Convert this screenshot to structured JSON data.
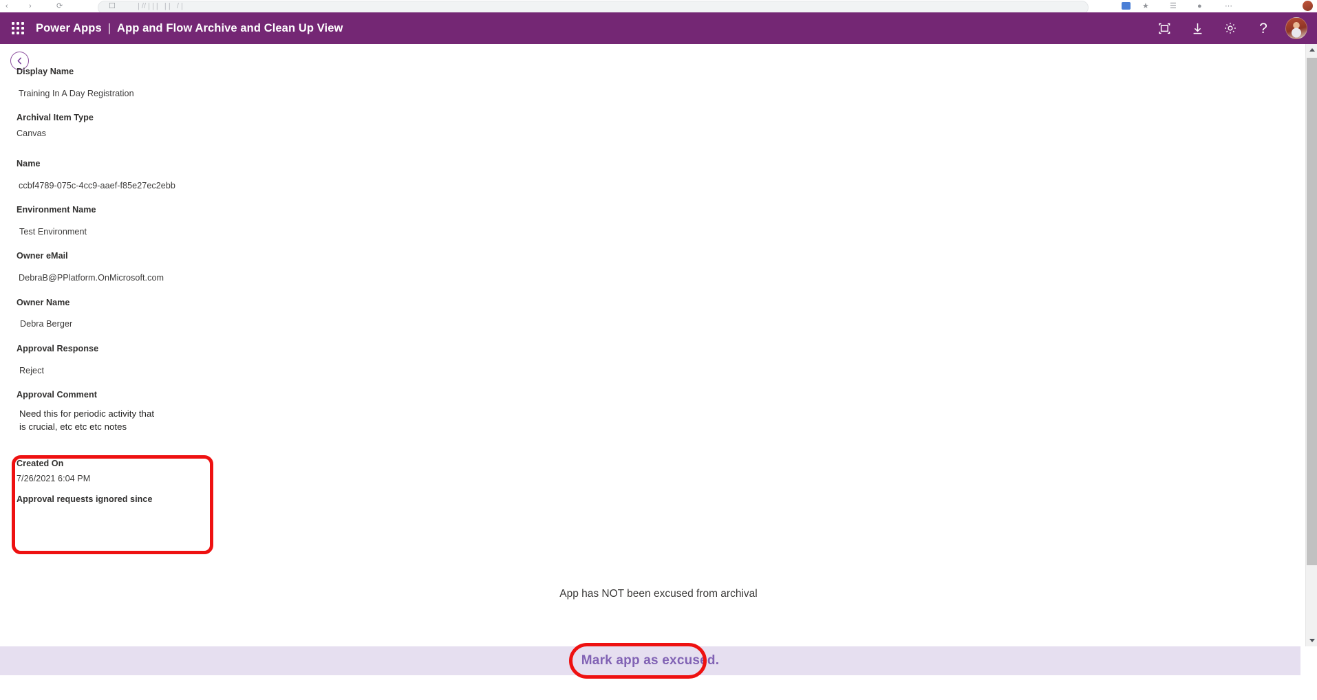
{
  "browser": {
    "url_placeholder": ""
  },
  "header": {
    "waffle_icon": "app-launcher-grid-icon",
    "brand": "Power Apps",
    "separator": "|",
    "app_title": "App and Flow Archive and Clean Up View",
    "icons": [
      {
        "name": "fit-to-screen-icon",
        "glyph": "fit-screen"
      },
      {
        "name": "download-icon",
        "glyph": "download"
      },
      {
        "name": "settings-gear-icon",
        "glyph": "gear"
      },
      {
        "name": "help-icon",
        "glyph": "?"
      }
    ],
    "help_glyph": "?",
    "avatar": "user-avatar",
    "bg_color": "#742774"
  },
  "form": {
    "back_label": "Back",
    "fields": [
      {
        "label": "Display Name",
        "value": "Training In A Day Registration"
      },
      {
        "label": "Archival Item Type",
        "value": "Canvas"
      },
      {
        "label": "Name",
        "value": "ccbf4789-075c-4cc9-aaef-f85e27ec2ebb"
      },
      {
        "label": "Environment Name",
        "value": "Test Environment"
      },
      {
        "label": "Owner eMail",
        "value": "DebraB@PPlatform.OnMicrosoft.com"
      },
      {
        "label": "Owner Name",
        "value": "Debra Berger"
      },
      {
        "label": "Approval Response",
        "value": "Reject"
      },
      {
        "label": "Approval Comment",
        "value": "Need this for periodic activity that is crucial, etc etc etc notes"
      },
      {
        "label": "Created On",
        "value": "7/26/2021 6:04 PM"
      },
      {
        "label": "Approval requests ignored since",
        "value": ""
      }
    ]
  },
  "footer": {
    "status_text": "App has NOT been excused from archival",
    "action_label": "Mark app as excused.",
    "band_color": "#e6dff0",
    "action_text_color": "#8162b4"
  },
  "annotations": {
    "highlight_color": "#ee1111",
    "items": [
      {
        "name": "approval-comment-highlight",
        "target": "Approval Comment"
      },
      {
        "name": "mark-app-as-excused-highlight",
        "target": "Mark app as excused."
      }
    ]
  },
  "scrollbar": {
    "up_arrow": "scroll-up-arrow",
    "down_arrow": "scroll-down-arrow",
    "thumb": "scroll-thumb"
  }
}
